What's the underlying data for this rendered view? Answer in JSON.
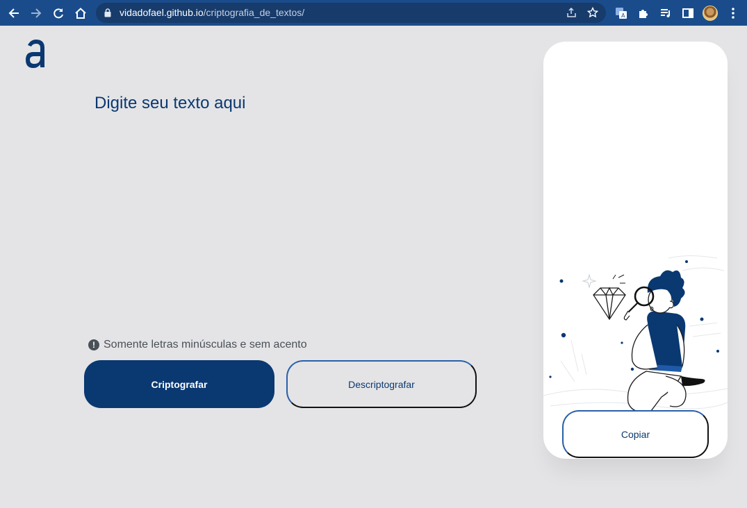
{
  "browser": {
    "url_host": "vidadofael.github.io",
    "url_path": "/criptografia_de_textos/",
    "icons": [
      "back-icon",
      "forward-icon",
      "reload-icon",
      "home-icon",
      "lock-icon",
      "share-icon",
      "star-icon",
      "translate-icon",
      "extensions-icon",
      "media-icon",
      "sidepanel-icon",
      "menu-icon"
    ]
  },
  "app": {
    "logo_letter": "a",
    "input": {
      "placeholder": "Digite seu texto aqui",
      "value": ""
    },
    "hint": {
      "icon": "!",
      "text": "Somente letras minúsculas e sem acento"
    },
    "encrypt_label": "Criptografar",
    "decrypt_label": "Descriptografar",
    "copy_label": "Copiar"
  },
  "colors": {
    "brand": "#0a3871",
    "chrome_bar": "#1a4c8b",
    "page_bg": "#e4e4e6",
    "card_bg": "#ffffff"
  }
}
